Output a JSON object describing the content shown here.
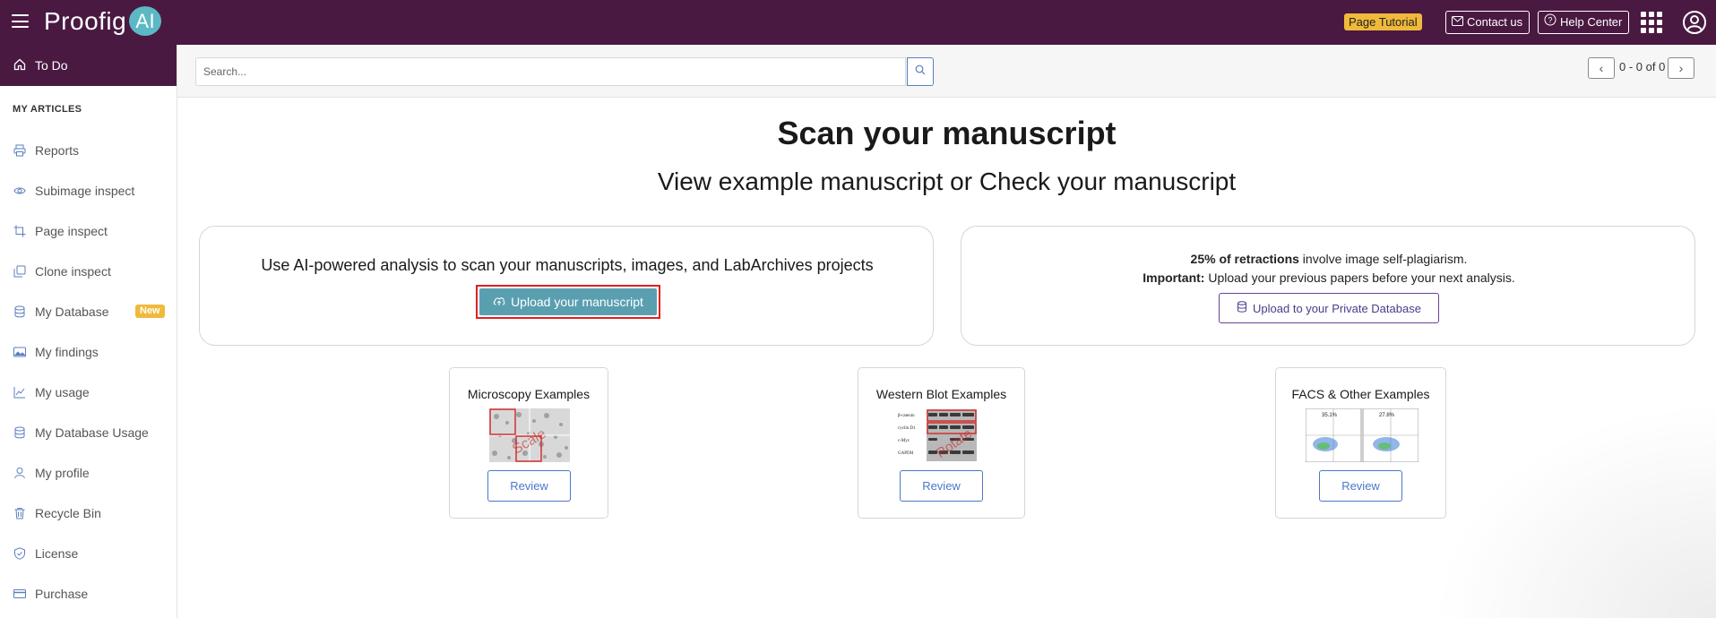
{
  "topbar": {
    "logo_text": "Proofig",
    "logo_badge": "AI",
    "page_tutorial": "Page Tutorial",
    "contact_us": "Contact us",
    "help_center": "Help Center"
  },
  "sidebar": {
    "todo": "To Do",
    "section": "MY ARTICLES",
    "items": [
      {
        "label": "Reports",
        "icon": "printer-icon"
      },
      {
        "label": "Subimage inspect",
        "icon": "eye-icon"
      },
      {
        "label": "Page inspect",
        "icon": "crop-icon"
      },
      {
        "label": "Clone inspect",
        "icon": "copy-icon"
      },
      {
        "label": "My Database",
        "icon": "database-icon",
        "badge": "New"
      },
      {
        "label": "My findings",
        "icon": "image-icon"
      },
      {
        "label": "My usage",
        "icon": "trend-icon"
      },
      {
        "label": "My Database Usage",
        "icon": "database-icon"
      },
      {
        "label": "My profile",
        "icon": "person-icon"
      },
      {
        "label": "Recycle Bin",
        "icon": "trash-icon"
      },
      {
        "label": "License",
        "icon": "shield-icon"
      },
      {
        "label": "Purchase",
        "icon": "card-icon"
      }
    ]
  },
  "search": {
    "placeholder": "Search...",
    "pager": "0 - 0 of 0"
  },
  "main": {
    "title": "Scan your manuscript",
    "subtitle": "View example manuscript or Check your manuscript",
    "left_card": {
      "lead": "Use AI-powered analysis to scan your manuscripts, images, and LabArchives projects",
      "upload": "Upload your manuscript"
    },
    "right_card": {
      "line1_bold": "25% of retractions",
      "line1_rest": " involve image self-plagiarism.",
      "line2_bold": "Important:",
      "line2_rest": " Upload your previous papers before your next analysis.",
      "private_db": "Upload to your Private Database"
    },
    "examples": [
      {
        "title": "Microscopy Examples",
        "review": "Review",
        "overlay": "Scale"
      },
      {
        "title": "Western Blot Examples",
        "review": "Review",
        "overlay": "Rotate",
        "lanes": [
          "β-catenin",
          "cyclin D1",
          "c-Myc",
          "GAPDH"
        ]
      },
      {
        "title": "FACS & Other Examples",
        "review": "Review",
        "values": [
          "35.1%",
          "27.8%"
        ]
      }
    ]
  },
  "colors": {
    "brand": "#4a1942",
    "accent_teal": "#5a9fb0",
    "badge_yellow": "#f0b93a",
    "link_blue": "#4a78c8"
  }
}
